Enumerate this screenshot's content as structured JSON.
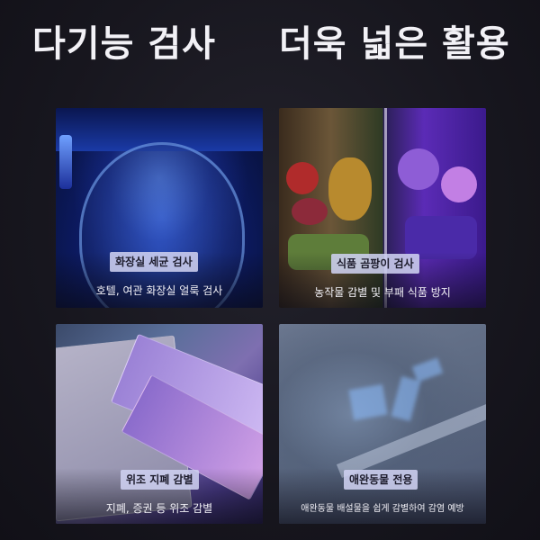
{
  "headlines": {
    "left": "다기능 검사",
    "right": "더욱 넓은 활용"
  },
  "cards": [
    {
      "label": "화장실 세균 검사",
      "caption": "호텔, 여관 화장실 얼룩 검사",
      "image": "uv-lit toilet bowl photo"
    },
    {
      "label": "식품 곰팡이 검사",
      "caption": "농작물 감별 및 부패 식품 방지",
      "image": "fruit and vegetables under normal and uv light photo"
    },
    {
      "label": "위조 지폐 감별",
      "caption": "지폐, 증권 등 위조 감별",
      "image": "banknotes under uv light photo"
    },
    {
      "label": "애완동물 전용",
      "caption": "애완동물 배설물을 쉽게 감별하여 감염 예방",
      "image": "pet stain glowing on floor photo"
    }
  ]
}
